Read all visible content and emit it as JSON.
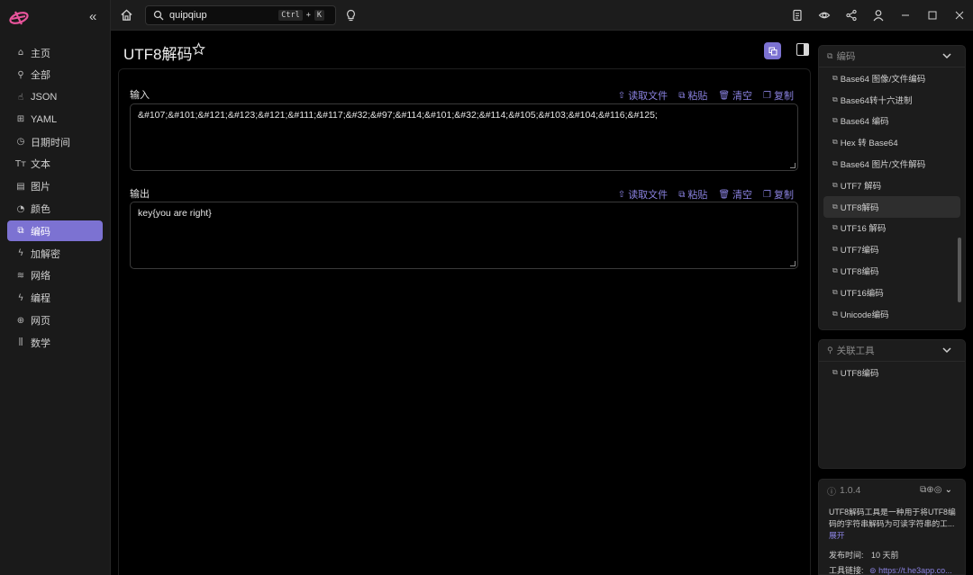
{
  "topbar": {
    "search_value": "quipqiup",
    "shortcut_ctrl": "Ctrl",
    "shortcut_plus": "+",
    "shortcut_key": "K"
  },
  "sidebar": {
    "items": [
      {
        "label": "主页",
        "icon": "home-icon",
        "glyph": "⌂"
      },
      {
        "label": "全部",
        "icon": "rocket-icon",
        "glyph": "⚲"
      },
      {
        "label": "JSON",
        "icon": "hand-icon",
        "glyph": "☝"
      },
      {
        "label": "YAML",
        "icon": "grid-icon",
        "glyph": "⊞"
      },
      {
        "label": "日期时间",
        "icon": "clock-icon",
        "glyph": "◷"
      },
      {
        "label": "文本",
        "icon": "text-icon",
        "glyph": "Tт"
      },
      {
        "label": "图片",
        "icon": "file-icon",
        "glyph": "▤"
      },
      {
        "label": "颜色",
        "icon": "palette-icon",
        "glyph": "◔"
      },
      {
        "label": "编码",
        "icon": "copy-icon",
        "glyph": "⧉",
        "active": true
      },
      {
        "label": "加解密",
        "icon": "bolt-icon",
        "glyph": "ϟ"
      },
      {
        "label": "网络",
        "icon": "wifi-icon",
        "glyph": "≋"
      },
      {
        "label": "编程",
        "icon": "code-icon",
        "glyph": "ϟ"
      },
      {
        "label": "网页",
        "icon": "globe-icon",
        "glyph": "⊕"
      },
      {
        "label": "数学",
        "icon": "chart-icon",
        "glyph": "⫼"
      }
    ]
  },
  "main": {
    "title": "UTF8解码",
    "input": {
      "label": "输入",
      "value": "&#107;&#101;&#121;&#123;&#121;&#111;&#117;&#32;&#97;&#114;&#101;&#32;&#114;&#105;&#103;&#104;&#116;&#125;"
    },
    "output": {
      "label": "输出",
      "value": "key{you are right}"
    },
    "actions": {
      "read_file": "读取文件",
      "paste": "粘贴",
      "clear": "清空",
      "copy": "复制"
    }
  },
  "right": {
    "encode_panel": {
      "title": "编码",
      "items": [
        "Base64 图像/文件编码",
        "Base64转十六进制",
        "Base64 编码",
        "Hex 转 Base64",
        "Base64 图片/文件解码",
        "UTF7 解码",
        "UTF8解码",
        "UTF16 解码",
        "UTF7编码",
        "UTF8编码",
        "UTF16编码",
        "Unicode编码"
      ],
      "active_index": 6
    },
    "related_panel": {
      "title": "关联工具",
      "items": [
        "UTF8编码"
      ]
    },
    "info_panel": {
      "version": "1.0.4",
      "description": "UTF8解码工具是一种用于将UTF8编码的字符串解码为可读字符串的工...",
      "expand": "展开",
      "publish_label": "发布时间:",
      "publish_value": "10 天前",
      "link_label": "工具链接:",
      "link_value": "https://t.he3app.co..."
    }
  },
  "colors": {
    "accent": "#7c72d2",
    "link": "#8a82e0"
  }
}
